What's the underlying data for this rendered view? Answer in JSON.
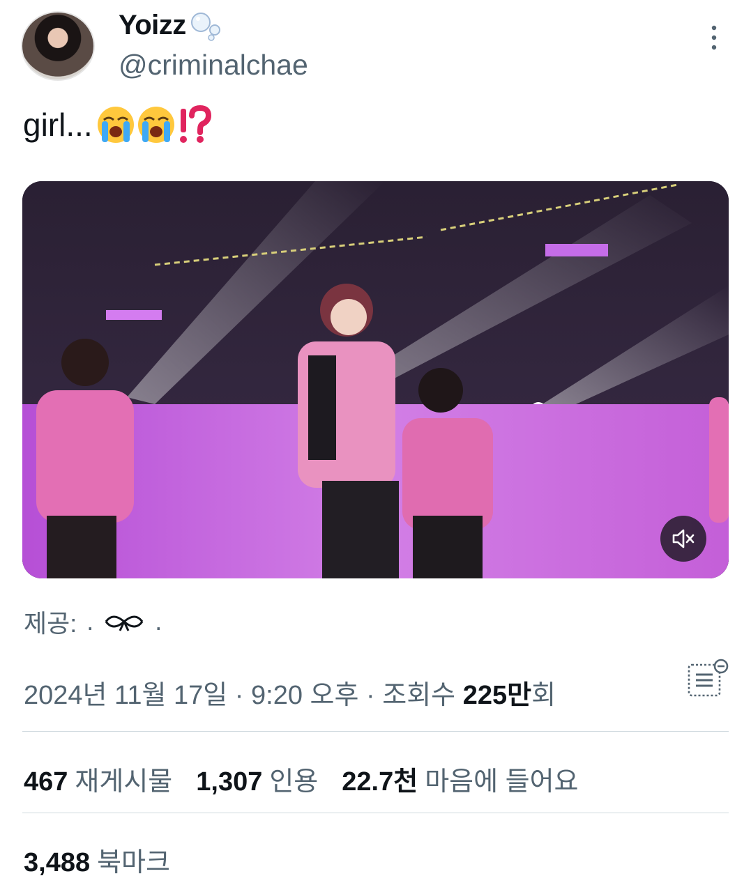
{
  "author": {
    "display_name": "Yoizz",
    "handle": "@criminalchae",
    "name_emoji_icon": "bubbles-icon"
  },
  "tweet": {
    "text": "girl...",
    "emojis": [
      "loudly-crying-face-icon",
      "loudly-crying-face-icon",
      "exclamation-question-mark-icon"
    ]
  },
  "media": {
    "type": "video",
    "mute_icon": "muted-speaker-icon"
  },
  "attribution": {
    "prefix": "제공:",
    "source_left": ".",
    "source_right": ".",
    "icon": "ribbon-icon"
  },
  "meta": {
    "date": "2024년 11월 17일",
    "sep1": " · ",
    "time": "9:20 오후",
    "sep2": " · ",
    "views_label": "조회수",
    "views_number": "225",
    "views_unit": "만",
    "views_suffix": "회"
  },
  "stats": {
    "reposts": {
      "count": "467",
      "label": "재게시물"
    },
    "quotes": {
      "count": "1,307",
      "label": "인용"
    },
    "likes": {
      "count": "22.7천",
      "label": "마음에 들어요"
    },
    "bookmarks": {
      "count": "3,488",
      "label": "북마크"
    }
  },
  "colors": {
    "text": "#0f1419",
    "secondary": "#536471",
    "divider": "#cfd9de",
    "accent_pink": "#e05aa8"
  }
}
